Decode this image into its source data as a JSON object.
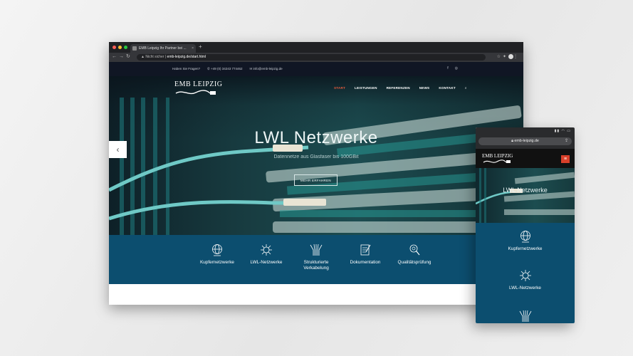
{
  "browser": {
    "tab_title": "EMB Leipzig Ihr Partner bei ...",
    "tab_close": "×",
    "new_tab": "+",
    "security": "Nicht sicher",
    "url": "emb-leipzig.de/start.html"
  },
  "site": {
    "topbar": {
      "question": "Haben Sie Fragen?",
      "phone": "+49 (0) 34243 774462",
      "email": "info@emb-leipzig.de"
    },
    "logo": "EMB LEIPZIG",
    "menu": [
      "START",
      "LEISTUNGEN",
      "REFERENZEN",
      "NEWS",
      "KONTAKT"
    ],
    "hero": {
      "title": "LWL Netzwerke",
      "subtitle": "Datennetze aus Glasfaser bis 100GBit",
      "button": "MEHR ERFAHREN",
      "prev": "‹"
    },
    "features": [
      {
        "label": "Kupfernetzwerke",
        "icon": "globe-icon"
      },
      {
        "label": "LWL-Netzwerke",
        "icon": "network-node-icon"
      },
      {
        "label": "Strukturierte Verkabelung",
        "icon": "cabling-icon"
      },
      {
        "label": "Dokumentation",
        "icon": "document-icon"
      },
      {
        "label": "Qualitätsprüfung",
        "icon": "magnifier-icon"
      }
    ]
  },
  "phone": {
    "url": "emb-leipzig.de",
    "logo": "EMB LEIPZIG",
    "menu_icon": "≡",
    "hero_title": "LWL Netzwerke",
    "features": [
      {
        "label": "Kupfernetzwerke",
        "icon": "globe-icon"
      },
      {
        "label": "LWL-Netzwerke",
        "icon": "network-node-icon"
      }
    ]
  },
  "colors": {
    "accent": "#e55a3c",
    "feature_bg": "#0c4e6f",
    "topbar_bg": "#101624"
  }
}
